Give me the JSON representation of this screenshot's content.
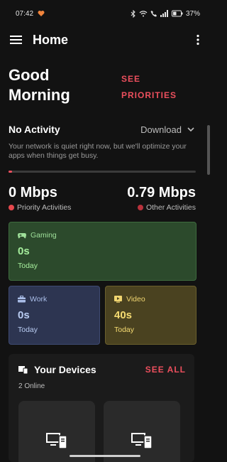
{
  "status_bar": {
    "time": "07:42",
    "battery": "37%"
  },
  "app_bar": {
    "title": "Home"
  },
  "greeting": {
    "line1": "Good",
    "line2": "Morning",
    "see_priorities_line1": "SEE",
    "see_priorities_line2": "PRIORITIES"
  },
  "activity": {
    "title": "No Activity",
    "dropdown_value": "Download",
    "description": "Your network is quiet right now, but we'll optimize your apps when things get busy.",
    "progress_fraction": 0.02
  },
  "speeds": {
    "priority": {
      "value": "0 Mbps",
      "label": "Priority Activities"
    },
    "other": {
      "value": "0.79 Mbps",
      "label": "Other Activities"
    }
  },
  "cards": {
    "gaming": {
      "label": "Gaming",
      "time": "0s",
      "period": "Today"
    },
    "work": {
      "label": "Work",
      "time": "0s",
      "period": "Today"
    },
    "video": {
      "label": "Video",
      "time": "40s",
      "period": "Today"
    }
  },
  "devices": {
    "title": "Your Devices",
    "see_all": "SEE ALL",
    "online": "2 Online"
  },
  "colors": {
    "accent": "#ec4f5d",
    "background": "#121212",
    "gaming": "#2c4a2c",
    "work": "#2d3551",
    "video": "#4a4220",
    "priority_dot": "#e5484d",
    "other_dot": "#b8323c"
  },
  "icons": [
    "heart-icon",
    "bluetooth-icon",
    "wifi-icon",
    "call-icon",
    "signal-icon",
    "battery-icon",
    "menu-icon",
    "more-vert-icon",
    "chevron-down-icon",
    "gamepad-icon",
    "briefcase-icon",
    "video-icon",
    "devices-icon",
    "computer-icon"
  ]
}
